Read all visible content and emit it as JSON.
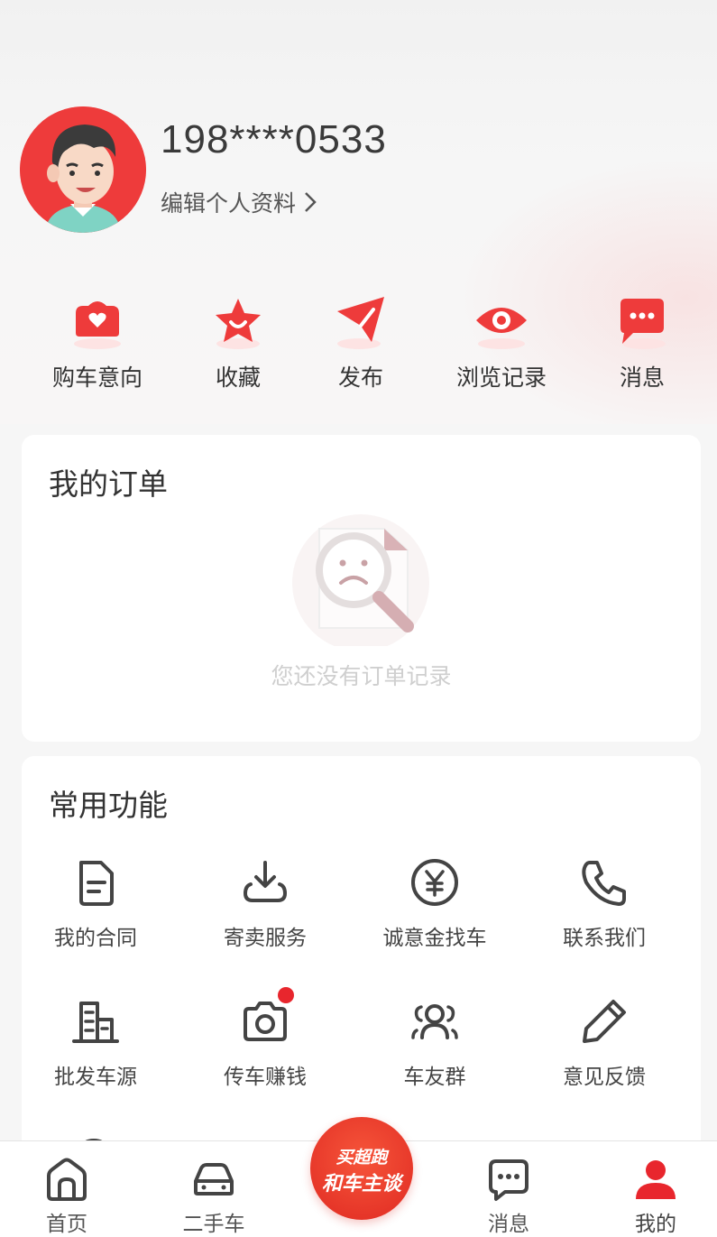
{
  "profile": {
    "phone": "198****0533",
    "edit_label": "编辑个人资料"
  },
  "quick_actions": [
    {
      "label": "购车意向",
      "icon": "heart-car-icon"
    },
    {
      "label": "收藏",
      "icon": "star-icon"
    },
    {
      "label": "发布",
      "icon": "send-icon"
    },
    {
      "label": "浏览记录",
      "icon": "eye-icon"
    },
    {
      "label": "消息",
      "icon": "chat-bubble-icon"
    }
  ],
  "orders": {
    "title": "我的订单",
    "empty_text": "您还没有订单记录"
  },
  "functions": {
    "title": "常用功能",
    "items": [
      {
        "label": "我的合同",
        "icon": "document-icon"
      },
      {
        "label": "寄卖服务",
        "icon": "download-tray-icon"
      },
      {
        "label": "诚意金找车",
        "icon": "yuan-coin-icon"
      },
      {
        "label": "联系我们",
        "icon": "phone-icon"
      },
      {
        "label": "批发车源",
        "icon": "buildings-icon"
      },
      {
        "label": "传车赚钱",
        "icon": "camera-icon"
      },
      {
        "label": "车友群",
        "icon": "group-icon"
      },
      {
        "label": "意见反馈",
        "icon": "pencil-icon"
      }
    ]
  },
  "nav": {
    "home": "首页",
    "used_car": "二手车",
    "center_line1": "买超跑",
    "center_line2": "和车主谈",
    "messages": "消息",
    "mine": "我的"
  },
  "colors": {
    "brand_red": "#e8262d",
    "card_bg": "#ffffff",
    "page_bg": "#f6f6f6"
  }
}
